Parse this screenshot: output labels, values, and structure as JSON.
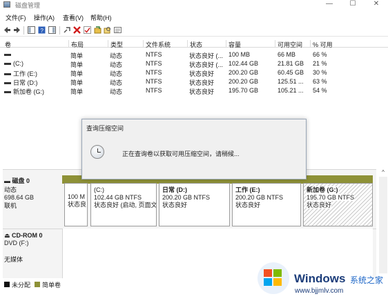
{
  "window": {
    "title": "磁盘管理",
    "minimize": "—",
    "maximize": "☐",
    "close": "✕"
  },
  "menu": [
    "文件(F)",
    "操作(A)",
    "查看(V)",
    "帮助(H)"
  ],
  "columns": [
    "卷",
    "布局",
    "类型",
    "文件系统",
    "状态",
    "容量",
    "可用空间",
    "% 可用"
  ],
  "volumes": [
    {
      "name": "",
      "layout": "简单",
      "type": "动态",
      "fs": "NTFS",
      "status": "状态良好 (...",
      "capacity": "100 MB",
      "free": "66 MB",
      "pct": "66 %"
    },
    {
      "name": "(C:)",
      "layout": "简单",
      "type": "动态",
      "fs": "NTFS",
      "status": "状态良好 (...",
      "capacity": "102.44 GB",
      "free": "21.81 GB",
      "pct": "21 %"
    },
    {
      "name": "工作 (E:)",
      "layout": "简单",
      "type": "动态",
      "fs": "NTFS",
      "status": "状态良好",
      "capacity": "200.20 GB",
      "free": "60.45 GB",
      "pct": "30 %"
    },
    {
      "name": "日常 (D:)",
      "layout": "简单",
      "type": "动态",
      "fs": "NTFS",
      "status": "状态良好",
      "capacity": "200.20 GB",
      "free": "125.51 ...",
      "pct": "63 %"
    },
    {
      "name": "新加卷 (G:)",
      "layout": "简单",
      "type": "动态",
      "fs": "NTFS",
      "status": "状态良好",
      "capacity": "195.70 GB",
      "free": "105.21 ...",
      "pct": "54 %"
    }
  ],
  "dialog": {
    "title": "查询压缩空间",
    "message": "正在查询卷以获取可用压缩空间，请稍候..."
  },
  "disk0": {
    "title": "磁盘 0",
    "type": "动态",
    "size": "698.64 GB",
    "state": "联机",
    "partitions": [
      {
        "line1": "100 M",
        "line2": "状态良",
        "line3": ""
      },
      {
        "line1": "(C:)",
        "line2": "102.44 GB NTFS",
        "line3": "状态良好 (启动, 页面文"
      },
      {
        "line1": "日常 (D:)",
        "line2": "200.20 GB NTFS",
        "line3": "状态良好"
      },
      {
        "line1": "工作 (E:)",
        "line2": "200.20 GB NTFS",
        "line3": "状态良好"
      },
      {
        "line1": "新加卷 (G:)",
        "line2": "195.70 GB NTFS",
        "line3": "状态良好"
      }
    ]
  },
  "cdrom0": {
    "title": "CD-ROM 0",
    "drive": "DVD (F:)",
    "media": "无媒体"
  },
  "legend": [
    {
      "label": "未分配",
      "color": "#111111"
    },
    {
      "label": "简单卷",
      "color": "#8e9137"
    }
  ],
  "watermark": {
    "brand": "Windows",
    "site": "系统之家",
    "url": "www.bjjmlv.com"
  },
  "colors": {
    "partition_cap": "#3b4fa8",
    "disk_strip": "#8e9137"
  }
}
